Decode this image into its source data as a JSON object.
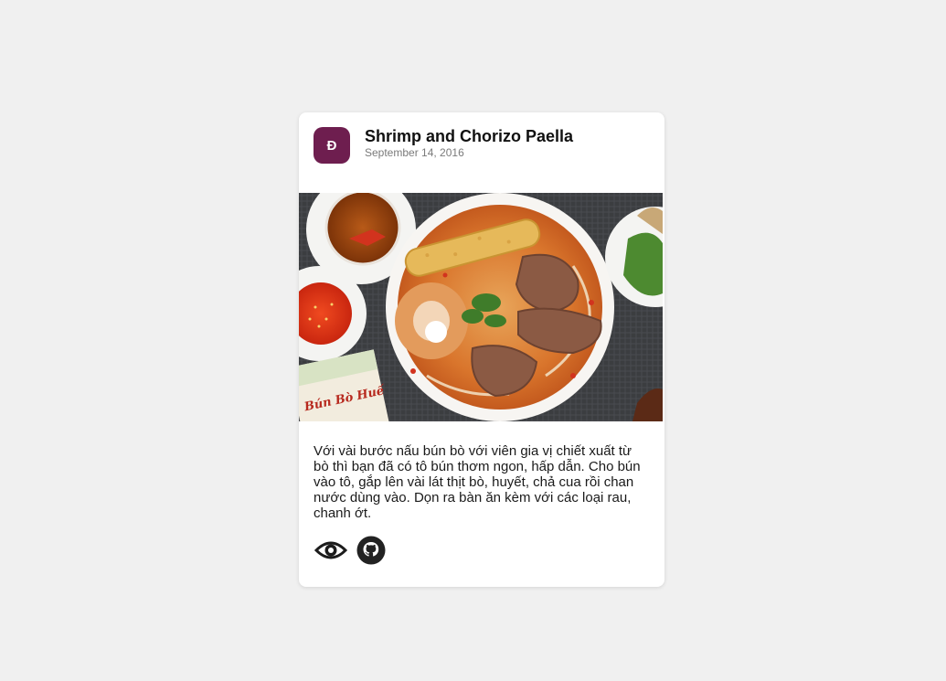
{
  "card": {
    "avatar_letter": "Đ",
    "avatar_color": "#6e1e4f",
    "title": "Shrimp and Chorizo Paella",
    "date": "September 14, 2016",
    "description": "Với vài bước nấu bún bò với viên gia vị chiết xuất từ bò thì bạn đã có tô bún thơm ngon, hấp dẫn. Cho bún vào tô, gắp lên vài lát thịt bò, huyết, chả cua rồi chan nước dùng vào. Dọn ra bàn ăn kèm với các loại rau, chanh ớt.",
    "image_package_text": "Bún Bò Huế",
    "actions": [
      {
        "icon": "eye-icon"
      },
      {
        "icon": "github-icon"
      }
    ]
  }
}
